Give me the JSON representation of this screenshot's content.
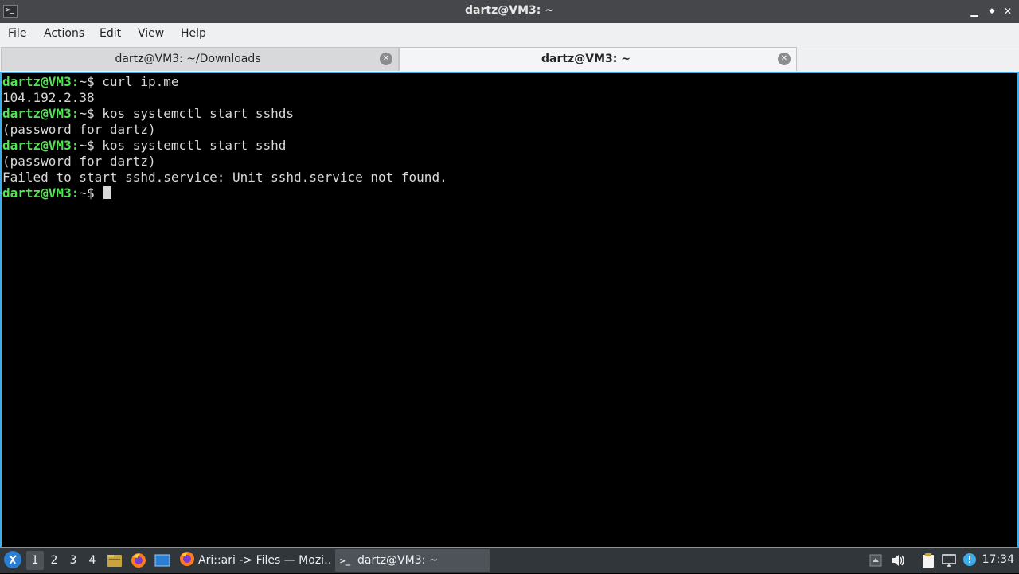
{
  "window": {
    "title": "dartz@VM3: ~",
    "app_icon": ">_",
    "controls": {
      "minimize": "▁",
      "maximize": "◆",
      "close": "✕"
    }
  },
  "menu": [
    "File",
    "Actions",
    "Edit",
    "View",
    "Help"
  ],
  "tabs": [
    {
      "label": "dartz@VM3: ~/Downloads",
      "active": false,
      "close_icon": "✕"
    },
    {
      "label": "dartz@VM3: ~",
      "active": true,
      "close_icon": "✕"
    }
  ],
  "terminal": {
    "lines": [
      {
        "prompt": "dartz@VM3:",
        "tail": "~$ curl ip.me"
      },
      {
        "text": "104.192.2.38"
      },
      {
        "prompt": "dartz@VM3:",
        "tail": "~$ kos systemctl start sshds"
      },
      {
        "text": "(password for dartz)"
      },
      {
        "prompt": "dartz@VM3:",
        "tail": "~$ kos systemctl start sshd"
      },
      {
        "text": "(password for dartz)"
      },
      {
        "text": "Failed to start sshd.service: Unit sshd.service not found."
      },
      {
        "prompt": "dartz@VM3:",
        "tail": "~$ "
      }
    ],
    "colors": {
      "background": "#000000",
      "prompt": "#54e354",
      "text": "#d9d9d9",
      "focus_border": "#3daee9"
    }
  },
  "taskbar": {
    "start_icon": "start-menu-icon",
    "desktops": [
      "1",
      "2",
      "3",
      "4"
    ],
    "current_desktop": "1",
    "quicklaunch": [
      "file-manager-icon",
      "firefox-icon",
      "show-desktop-icon"
    ],
    "tasks": [
      {
        "icon": "firefox-icon",
        "label": "Ari::ari -> Files — Mozi…",
        "active": false
      },
      {
        "icon": "terminal-icon",
        "label": "dartz@VM3: ~",
        "active": true
      }
    ],
    "tray": [
      "show-hidden-icon",
      "volume-icon",
      "clipboard-icon",
      "screen-icon",
      "update-icon"
    ],
    "clock": "17:34"
  }
}
